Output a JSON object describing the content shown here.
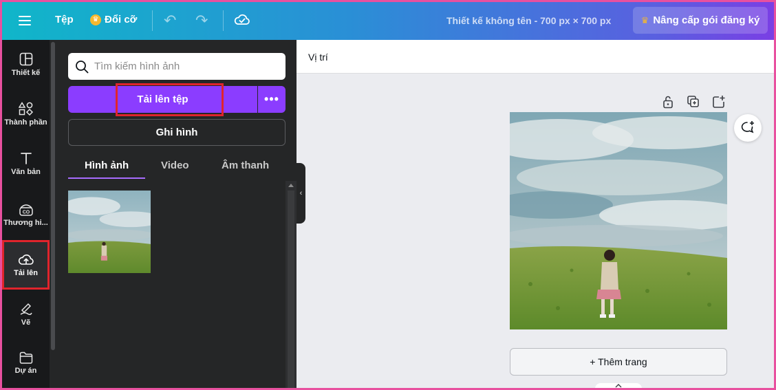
{
  "topbar": {
    "file_label": "Tệp",
    "resize_label": "Đổi cỡ",
    "document_title": "Thiết kế không tên - 700 px × 700 px",
    "upgrade_label": "Nâng cấp gói đăng ký",
    "icons": [
      "menu-icon",
      "crown-icon",
      "undo-icon",
      "redo-icon",
      "cloud-check-icon"
    ]
  },
  "rail": {
    "items": [
      {
        "label": "Thiết kế",
        "icon": "layout-icon"
      },
      {
        "label": "Thành phần",
        "icon": "shapes-icon"
      },
      {
        "label": "Văn bản",
        "icon": "text-icon"
      },
      {
        "label": "Thương hi...",
        "icon": "brand-icon"
      },
      {
        "label": "Tải lên",
        "icon": "cloud-upload-icon"
      },
      {
        "label": "Vẽ",
        "icon": "draw-icon"
      },
      {
        "label": "Dự án",
        "icon": "folder-icon"
      }
    ],
    "active_index": 4
  },
  "panel": {
    "search_placeholder": "Tìm kiếm hình ảnh",
    "upload_label": "Tải lên tệp",
    "more_label": "•••",
    "record_label": "Ghi hình",
    "tabs": [
      {
        "label": "Hình ảnh"
      },
      {
        "label": "Video"
      },
      {
        "label": "Âm thanh"
      }
    ],
    "active_tab": 0
  },
  "canvas": {
    "position_label": "Vị trí",
    "add_page_label": "+ Thêm trang"
  },
  "colors": {
    "accent_purple": "#8b3dff",
    "highlight_red": "#e0242c",
    "rail_bg": "#18191b",
    "panel_bg": "#252627",
    "outer_border": "#e8509f"
  }
}
